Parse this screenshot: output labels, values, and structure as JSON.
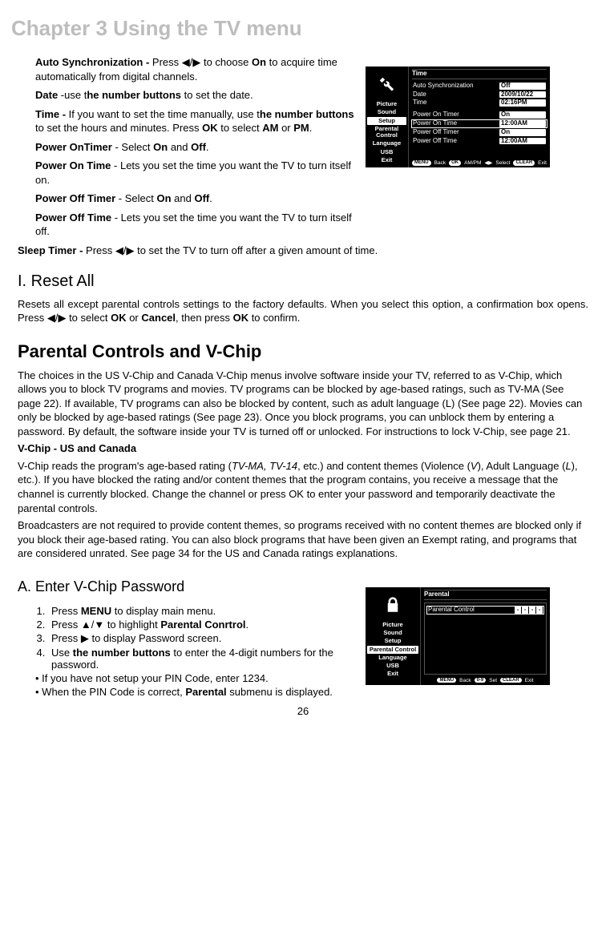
{
  "chapter_title": "Chapter 3 Using the TV menu",
  "page_number": "26",
  "items": {
    "autosync": "Auto Synchronization - Press ◀/▶ to choose On to acquire time automatically from digital channels.",
    "date": "Date -use the number buttons to set the date.",
    "time": "Time - If you want to set the time manually, use the number buttons to set the hours and minutes. Press OK to select AM or PM.",
    "pon_timer": "Power OnTimer - Select On and Off.",
    "pon_time": "Power On Time - Lets you set the time you want the TV to turn itself on.",
    "poff_timer": "Power Off Timer - Select On and Off.",
    "poff_time": "Power Off Time - Lets you set the time you want the TV to turn itself off.",
    "sleep": "Sleep Timer - Press ◀/▶ to set the TV to turn off after a given amount of time."
  },
  "sections": {
    "reset_title": "I. Reset All",
    "reset_body": "Resets all except parental controls settings to the factory defaults. When you select this option, a confirmation box opens. Press ◀/▶ to select OK or Cancel, then press OK to confirm.",
    "vchip_title": "Parental Controls and V-Chip",
    "vchip_p1": "The choices in the US V-Chip and Canada V-Chip menus involve software inside your TV, referred to as V-Chip, which allows you to block TV programs and movies. TV programs can be blocked by age-based ratings, such as TV-MA (See page 22). If available, TV programs can also be blocked by content, such as adult language (L) (See page 22). Movies can only be blocked by age-based ratings (See page 23). Once you block programs, you can unblock them by entering a password. By default, the software inside your TV is turned off or unlocked. For instructions to lock V-Chip, see page 21.",
    "vchip_sub": "V-Chip - US and Canada",
    "vchip_p2": "V-Chip reads the program's age-based rating (TV-MA, TV-14, etc.) and content themes (Violence (V), Adult Language (L), etc.). If you have blocked the rating and/or content themes that the program contains, you receive a message that the channel is currently blocked. Change the channel or press OK to enter your password and temporarily deactivate the parental controls.",
    "vchip_p3": "Broadcasters are not required to provide content themes, so programs received with no content themes are blocked only if you block their age-based rating. You can also block programs that have been given an Exempt rating, and programs that are considered unrated. See page 34 for the US and Canada ratings explanations.",
    "enter_title": "A. Enter V-Chip Password"
  },
  "steps": [
    "Press MENU to display main menu.",
    "Press ▲/▼ to highlight Parental Conrtrol.",
    "Press ▶ to display Password screen.",
    "Use the number buttons to enter the 4-digit numbers for the password."
  ],
  "bullets": [
    "If you have not setup your PIN Code, enter 1234.",
    "When the PIN Code is correct, Parental submenu is displayed."
  ],
  "osd1": {
    "menu": [
      "Picture",
      "Sound",
      "Setup",
      "Parental Control",
      "Language",
      "USB",
      "Exit"
    ],
    "selected": "Setup",
    "title": "Time",
    "rows1": [
      {
        "label": "Auto Synchronization",
        "val": "Off"
      },
      {
        "label": "Date",
        "val": "2009/10/22"
      },
      {
        "label": "Time",
        "val": "02:16PM"
      }
    ],
    "rows2": [
      {
        "label": "Power On Timer",
        "val": "On"
      },
      {
        "label": "Power On Time",
        "val": "12:00AM",
        "hl": true
      },
      {
        "label": "Power Off Timer",
        "val": "On"
      },
      {
        "label": "Power Off Time",
        "val": "12:00AM"
      }
    ],
    "footer": {
      "back": "Back",
      "ampm": "AM/PM",
      "select": "Select",
      "exit": "Exit"
    },
    "buttons": {
      "menu": "MENU",
      "ok": "OK",
      "clear": "CLEAR"
    }
  },
  "osd2": {
    "menu": [
      "Picture",
      "Sound",
      "Setup",
      "Parental Control",
      "Language",
      "USB",
      "Exit"
    ],
    "selected": "Parental Control",
    "title": "Parental",
    "label": "Parental Control",
    "pwd": "- - - -",
    "footer": {
      "back": "Back",
      "set": "Set",
      "exit": "Exit"
    },
    "buttons": {
      "menu": "MENU",
      "num": "0-9",
      "clear": "CLEAR"
    }
  }
}
